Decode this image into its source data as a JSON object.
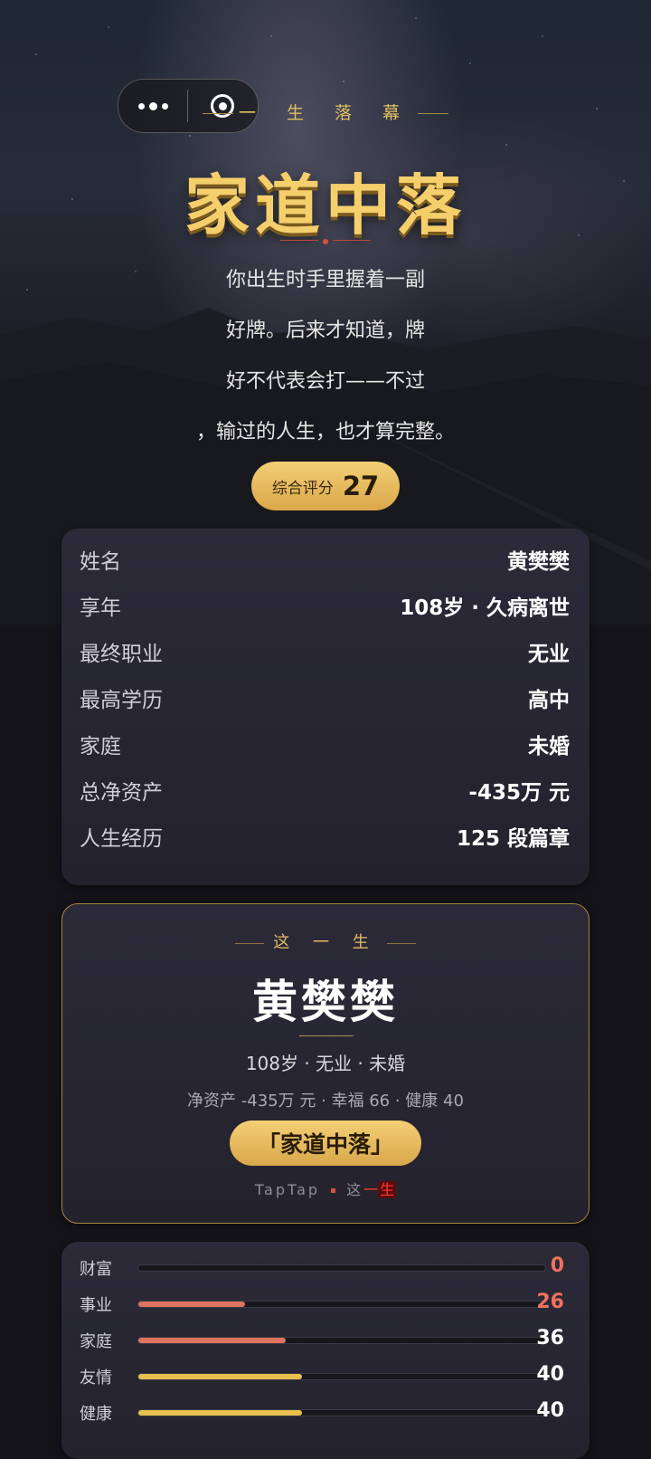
{
  "header": {
    "subtitle": "一 生 落 幕",
    "title": "家道中落",
    "description": "你出生时手里握着一副好牌。后来才知道，牌好不代表会打——不过，输过的人生，也才算完整。",
    "score_label": "综合评分",
    "score_value": "27"
  },
  "info": {
    "rows": [
      {
        "key": "姓名",
        "value": "黄樊樊"
      },
      {
        "key": "享年",
        "value": "108岁 · 久病离世"
      },
      {
        "key": "最终职业",
        "value": "无业"
      },
      {
        "key": "最高学历",
        "value": "高中"
      },
      {
        "key": "家庭",
        "value": "未婚"
      },
      {
        "key": "总净资产",
        "value": "-435万 元"
      },
      {
        "key": "人生经历",
        "value": "125 段篇章"
      }
    ]
  },
  "summary": {
    "heading": "这 一 生",
    "name": "黄樊樊",
    "line1": "108岁 · 无业 · 未婚",
    "line2": "净资产 -435万 元 · 幸福 66 · 健康 40",
    "verdict": "「家道中落」",
    "footer_brand": "TapTap",
    "footer_text_a": "这",
    "footer_text_b": "一",
    "footer_text_c": "生"
  },
  "stats": [
    {
      "name": "财富",
      "value": 0,
      "fraction": 0.0,
      "color": "#e0735f",
      "num_color": "#f0715e"
    },
    {
      "name": "事业",
      "value": 26,
      "fraction": 0.26,
      "color": "#e0735f",
      "num_color": "#f0715e"
    },
    {
      "name": "家庭",
      "value": 36,
      "fraction": 0.36,
      "color": "#e0735f",
      "num_color": "#ffffff"
    },
    {
      "name": "友情",
      "value": 40,
      "fraction": 0.4,
      "color": "#e9bf4e",
      "num_color": "#ffffff"
    },
    {
      "name": "健康",
      "value": 40,
      "fraction": 0.4,
      "color": "#e9bf4e",
      "num_color": "#ffffff"
    }
  ],
  "colors": {
    "accent_gold": "#f6cf6d",
    "accent_red": "#d4513f",
    "card_bg": "#2a2835"
  }
}
